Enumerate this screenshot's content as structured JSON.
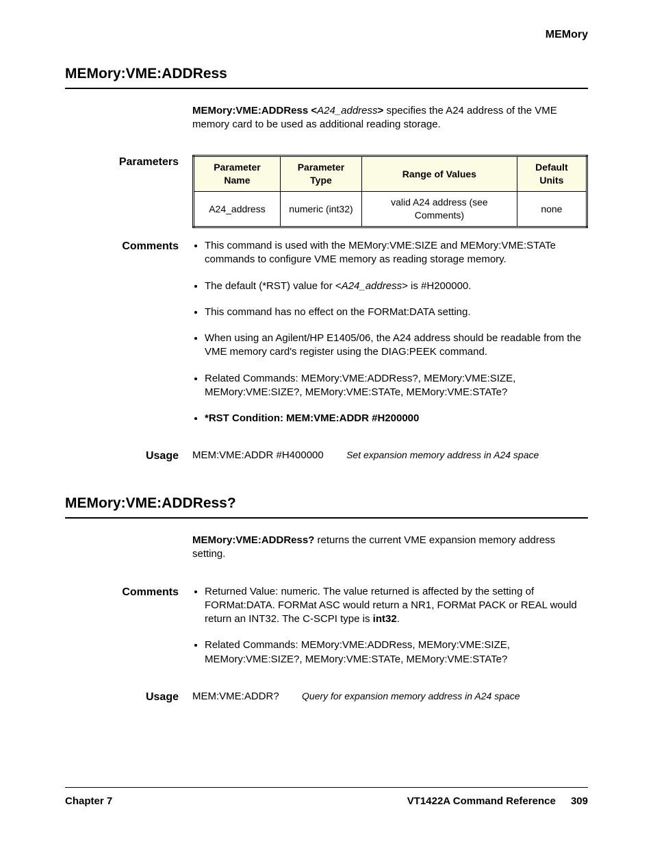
{
  "header": {
    "category": "MEMory"
  },
  "sec1": {
    "heading": "MEMory:VME:ADDRess",
    "cmd_bold": "MEMory:VME:ADDRess  <",
    "cmd_param": "A24_address",
    "cmd_close": ">",
    "desc": " specifies the A24 address of the VME memory card to be used as additional reading storage.",
    "params_label": "Parameters",
    "table": {
      "h1": "Parameter Name",
      "h2": "Parameter Type",
      "h3": "Range of Values",
      "h4": "Default Units",
      "r1c1": "A24_address",
      "r1c2": "numeric (int32)",
      "r1c3": "valid A24 address (see Comments)",
      "r1c4": "none"
    },
    "comments_label": "Comments",
    "c1_a": "This command is used with the MEMory:VME:SIZE and MEMory:VME:STATe commands to configure VME memory as reading storage memory.",
    "c2_a": "The default (*RST) value for <",
    "c2_b": "A24_address",
    "c2_c": "> is #H200000.",
    "c3_a": "This command has no effect on the FORMat:DATA setting.",
    "c4_a": "When using an Agilent/HP E1405/06, the A24 address should be readable from the VME memory card's register using the DIAG:PEEK command.",
    "c5_a": "Related Commands: MEMory:VME:ADDRess?, MEMory:VME:SIZE, MEMory:VME:SIZE?, MEMory:VME:STATe, MEMory:VME:STATe?",
    "c6_a": "*RST Condition: MEM:VME:ADDR #H200000",
    "usage_label": "Usage",
    "u1": "MEM:VME:ADDR #H400000",
    "u1_note": "Set expansion memory address in A24 space"
  },
  "sec2": {
    "heading": "MEMory:VME:ADDRess?",
    "cmd_bold": "MEMory:VME:ADDRess?",
    "desc": " returns the current VME expansion memory address setting.",
    "comments_label": "Comments",
    "c1_a": "Returned Value: numeric. The value returned is affected by the setting of FORMat:DATA. FORMat ASC would return a NR1, FORMat PACK or REAL would return an INT32. The C-SCPI type is ",
    "c1_b": "int32",
    "c1_c": ".",
    "c2_a": "Related Commands: MEMory:VME:ADDRess, MEMory:VME:SIZE, MEMory:VME:SIZE?, MEMory:VME:STATe, MEMory:VME:STATe?",
    "usage_label": "Usage",
    "u1": "MEM:VME:ADDR?",
    "u1_note": "Query for expansion memory address in A24 space"
  },
  "footer": {
    "left": "Chapter 7",
    "right_title": "VT1422A Command Reference",
    "page": "309"
  }
}
